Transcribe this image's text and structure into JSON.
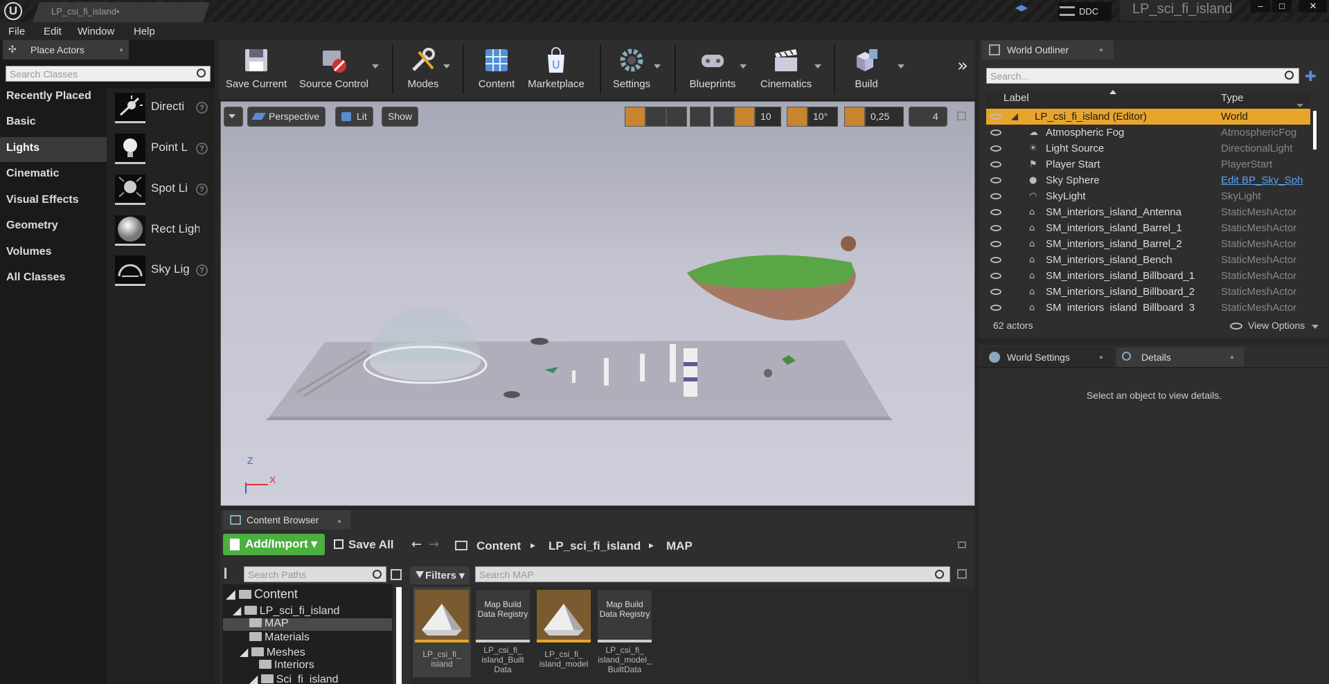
{
  "titlebar": {
    "doc_tab": "LP_csi_fi_island•",
    "ddc": "DDC",
    "project_title": "LP_sci_fi_island",
    "minimize": "–",
    "restore": "□",
    "close": "✕"
  },
  "menu": [
    "File",
    "Edit",
    "Window",
    "Help"
  ],
  "place_actors": {
    "tab_title": "Place Actors",
    "search_placeholder": "Search Classes",
    "categories": [
      "Recently Placed",
      "Basic",
      "Lights",
      "Cinematic",
      "Visual Effects",
      "Geometry",
      "Volumes",
      "All Classes"
    ],
    "selected_category": "Lights",
    "items": [
      "Directi",
      "Point L",
      "Spot Li",
      "Rect Light",
      "Sky Lig"
    ]
  },
  "toolbar": {
    "save_current": "Save Current",
    "source_control": "Source Control",
    "modes": "Modes",
    "content": "Content",
    "marketplace": "Marketplace",
    "settings": "Settings",
    "blueprints": "Blueprints",
    "cinematics": "Cinematics",
    "build": "Build",
    "more": "»"
  },
  "viewport": {
    "perspective": "Perspective",
    "lit": "Lit",
    "show": "Show",
    "grid_snap": "10",
    "rotation_snap": "10°",
    "scale_snap": "0,25",
    "camera_speed": "4",
    "axis_z": "Z",
    "axis_x": "X"
  },
  "outliner": {
    "tab_title": "World Outliner",
    "search_placeholder": "Search...",
    "col_label": "Label",
    "col_type": "Type",
    "rows": [
      {
        "label": "LP_csi_fi_island (Editor)",
        "type": "World"
      },
      {
        "label": "Atmospheric Fog",
        "type": "AtmosphericFog"
      },
      {
        "label": "Light Source",
        "type": "DirectionalLight"
      },
      {
        "label": "Player Start",
        "type": "PlayerStart"
      },
      {
        "label": "Sky Sphere",
        "type": "Edit BP_Sky_Sph"
      },
      {
        "label": "SkyLight",
        "type": "SkyLight"
      },
      {
        "label": "SM_interiors_island_Antenna",
        "type": "StaticMeshActor"
      },
      {
        "label": "SM_interiors_island_Barrel_1",
        "type": "StaticMeshActor"
      },
      {
        "label": "SM_interiors_island_Barrel_2",
        "type": "StaticMeshActor"
      },
      {
        "label": "SM_interiors_island_Bench",
        "type": "StaticMeshActor"
      },
      {
        "label": "SM_interiors_island_Billboard_1",
        "type": "StaticMeshActor"
      },
      {
        "label": "SM_interiors_island_Billboard_2",
        "type": "StaticMeshActor"
      },
      {
        "label": "SM_interiors_island_Billboard_3",
        "type": "StaticMeshActor"
      }
    ],
    "actor_count": "62 actors",
    "view_options": "View Options"
  },
  "details": {
    "world_settings_tab": "World Settings",
    "details_tab": "Details",
    "empty_message": "Select an object to view details."
  },
  "content_browser": {
    "tab_title": "Content Browser",
    "add_import": "Add/Import",
    "save_all": "Save All",
    "breadcrumb": [
      "Content",
      "LP_sci_fi_island",
      "MAP"
    ],
    "search_paths_placeholder": "Search Paths",
    "filters": "Filters",
    "search_map_placeholder": "Search MAP",
    "tree": [
      "Content",
      "LP_sci_fi_island",
      "MAP",
      "Materials",
      "Meshes",
      "Interiors",
      "Sci_fi_island"
    ],
    "assets": [
      {
        "name": "LP_csi_fi_island",
        "thumb_text": ""
      },
      {
        "name": "LP_csi_fi_island_BuiltData",
        "thumb_text": "Map Build Data Registry"
      },
      {
        "name": "LP_csi_fi_island_model",
        "thumb_text": ""
      },
      {
        "name": "LP_csi_fi_island_model_BuiltData",
        "thumb_text": "Map Build Data Registry"
      }
    ],
    "asset_labels": [
      [
        "LP_csi_fi_",
        "island"
      ],
      [
        "LP_csi_fi_",
        "island_Built",
        "Data"
      ],
      [
        "LP_csi_fi_",
        "island_model"
      ],
      [
        "LP_csi_fi_",
        "island_model_",
        "BuiltData"
      ]
    ]
  },
  "colors": {
    "accent_orange": "#e8a52b",
    "add_import_green": "#4caf3f",
    "link_blue": "#5aa0f0"
  }
}
